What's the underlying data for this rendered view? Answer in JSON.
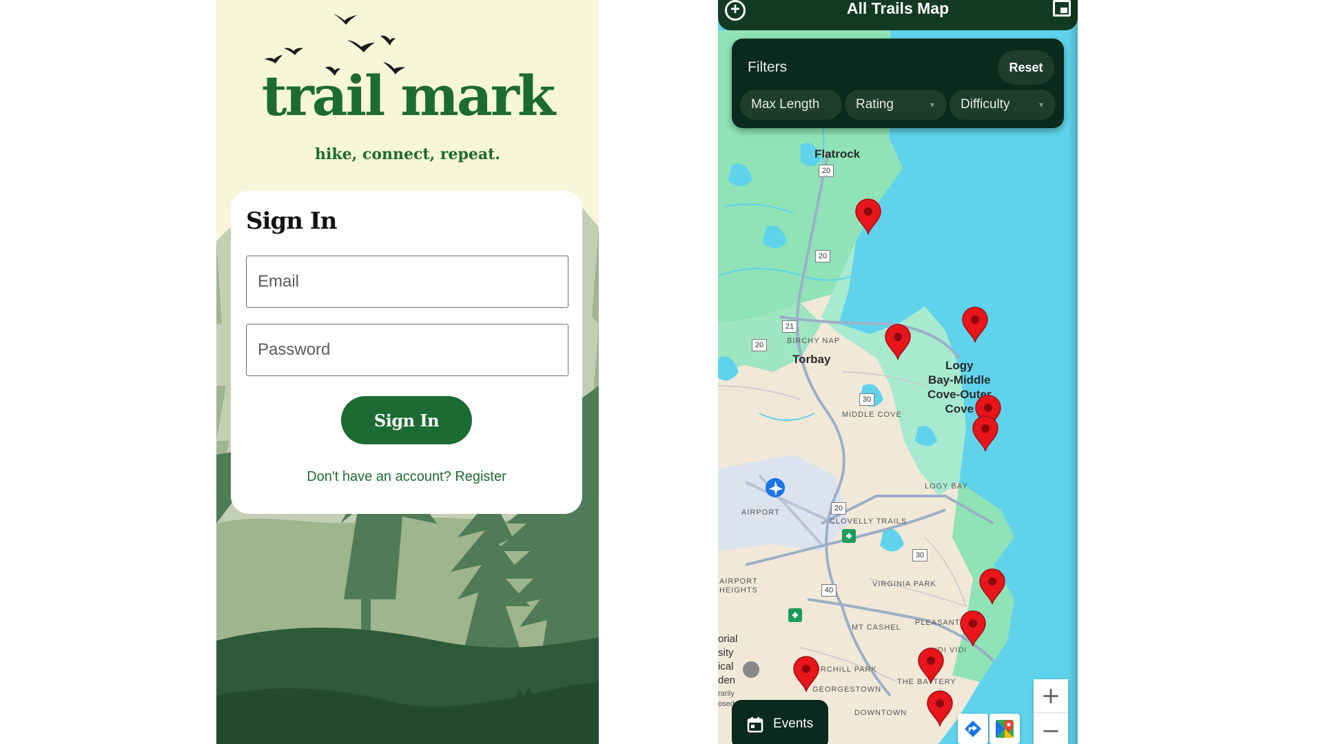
{
  "signin": {
    "brand_title": "trail mark",
    "tagline": "hike, connect, repeat.",
    "heading": "Sign In",
    "email_placeholder": "Email",
    "password_placeholder": "Password",
    "submit_label": "Sign In",
    "register_link": "Don't have an account? Register",
    "colors": {
      "brand_green": "#1c6b32",
      "background_cream": "#f7f6d9"
    }
  },
  "map": {
    "header_title": "All Trails Map",
    "filters": {
      "label": "Filters",
      "reset_label": "Reset",
      "chips": [
        {
          "label": "Max Length"
        },
        {
          "label": "Rating"
        },
        {
          "label": "Difficulty"
        }
      ]
    },
    "places": {
      "flatrock": "Flatrock",
      "birchy_nap": "BIRCHY NAP",
      "torbay": "Torbay",
      "logy_bay_1": "Logy",
      "logy_bay_2": "Bay-Middle",
      "logy_bay_3": "Cove-Outer",
      "logy_bay_4": "Cove",
      "middle_cove": "MIDDLE COVE",
      "logy_bay_small": "LOGY BAY",
      "airport": "AIRPORT",
      "clovelly": "CLOVELLY TRAILS",
      "airport_heights_1": "AIRPORT",
      "airport_heights_2": "HEIGHTS",
      "virginia_park": "VIRGINIA PARK",
      "mt_cashel": "MT CASHEL",
      "pleasant": "PLEASANT",
      "quidi_vidi": "UIDI VIDI",
      "churchill_park": "CHURCHILL PARK",
      "the_battery": "THE BATTERY",
      "georgestown": "GEORGESTOWN",
      "downtown": "DOWNTOWN",
      "edge_1": "orial",
      "edge_2": "sity",
      "edge_3": "ical",
      "edge_4": "den",
      "edge_5": "rarily",
      "edge_6": "osed"
    },
    "route_shields": {
      "s1": "20",
      "s2": "20",
      "s3": "21",
      "s4": "20",
      "s5": "30",
      "s6": "20",
      "s7": "30",
      "s8": "40"
    },
    "events_label": "Events",
    "zoom_in": "+",
    "zoom_out": "−",
    "colors": {
      "water": "#5fd3ec",
      "land": "#f1e8d8",
      "park": "#8fe3b6",
      "pin": "#e8151b",
      "dark_panel": "#0a2a1d"
    }
  }
}
